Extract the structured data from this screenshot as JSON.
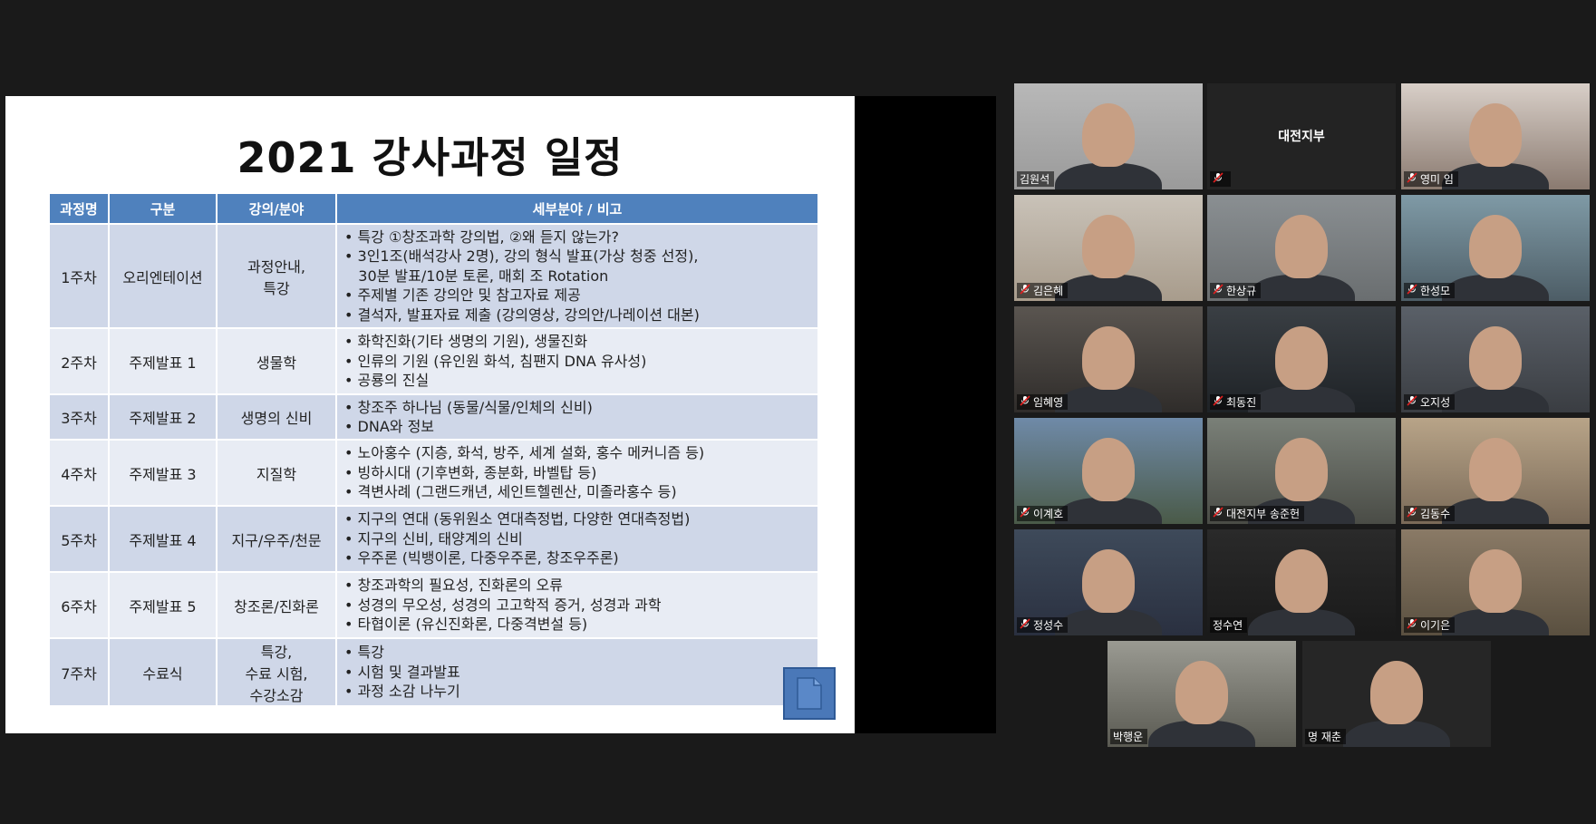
{
  "slide": {
    "title": "2021 강사과정 일정",
    "headers": [
      "과정명",
      "구분",
      "강의/분야",
      "세부분야 / 비고"
    ],
    "rows": [
      {
        "week": "1주차",
        "type": "오리엔테이션",
        "field": [
          "과정안내,",
          "특강"
        ],
        "details": [
          "• 특강 ①창조과학 강의법, ②왜 듣지 않는가?",
          "• 3인1조(배석강사 2명), 강의 형식 발표(가상 청중 선정),",
          "   30분 발표/10분 토론, 매회 조 Rotation",
          "• 주제별 기존 강의안 및 참고자료 제공",
          "• 결석자, 발표자료 제출 (강의영상, 강의안/나레이션 대본)"
        ]
      },
      {
        "week": "2주차",
        "type": "주제발표 1",
        "field": [
          "생물학"
        ],
        "details": [
          "• 화학진화(기타 생명의 기원), 생물진화",
          "• 인류의 기원 (유인원 화석, 침팬지 DNA 유사성)",
          "• 공룡의 진실"
        ]
      },
      {
        "week": "3주차",
        "type": "주제발표 2",
        "field": [
          "생명의 신비"
        ],
        "details": [
          "• 창조주 하나님 (동물/식물/인체의 신비)",
          "• DNA와 정보"
        ]
      },
      {
        "week": "4주차",
        "type": "주제발표 3",
        "field": [
          "지질학"
        ],
        "details": [
          "• 노아홍수 (지층, 화석, 방주, 세계 설화, 홍수 메커니즘 등)",
          "• 빙하시대 (기후변화, 종분화, 바벨탑 등)",
          "• 격변사례 (그랜드캐년, 세인트헬렌산, 미졸라홍수 등)"
        ]
      },
      {
        "week": "5주차",
        "type": "주제발표 4",
        "field": [
          "지구/우주/천문"
        ],
        "details": [
          "• 지구의 연대 (동위원소 연대측정법, 다양한 연대측정법)",
          "• 지구의 신비, 태양계의 신비",
          "• 우주론 (빅뱅이론, 다중우주론, 창조우주론)"
        ]
      },
      {
        "week": "6주차",
        "type": "주제발표 5",
        "field": [
          "창조론/진화론"
        ],
        "details": [
          "• 창조과학의 필요성, 진화론의 오류",
          "• 성경의 무오성, 성경의 고고학적 증거, 성경과 과학",
          "• 타협이론 (유신진화론, 다중격변설 등)"
        ]
      },
      {
        "week": "7주차",
        "type": "수료식",
        "field": [
          "특강,",
          "수료 시험,",
          "수강소감"
        ],
        "details": [
          "• 특강",
          "• 시험 및 결과발표",
          "• 과정 소감 나누기"
        ]
      }
    ]
  },
  "participants": [
    {
      "name": "김원석",
      "muted": false
    },
    {
      "name": "대전지부",
      "muted": true,
      "video_off": true
    },
    {
      "name": "영미 임",
      "muted": true
    },
    {
      "name": "김은혜",
      "muted": true
    },
    {
      "name": "한상규",
      "muted": true
    },
    {
      "name": "한성모",
      "muted": true
    },
    {
      "name": "임혜영",
      "muted": true
    },
    {
      "name": "최동진",
      "muted": true
    },
    {
      "name": "오지성",
      "muted": true
    },
    {
      "name": "이계호",
      "muted": true
    },
    {
      "name": "대전지부 송준헌",
      "muted": true
    },
    {
      "name": "김동수",
      "muted": true
    },
    {
      "name": "정성수",
      "muted": true
    },
    {
      "name": "정수연",
      "muted": false
    },
    {
      "name": "이기은",
      "muted": true
    },
    {
      "name": "박행운",
      "muted": false,
      "active_speaker": true
    },
    {
      "name": "명 재춘",
      "muted": false
    }
  ],
  "colors": {
    "header_blue": "#4f81bd",
    "row_dark": "#cfd7e8",
    "row_light": "#e8ecf4",
    "speaker_border": "#c9e06b",
    "mute_red": "#e02020"
  }
}
